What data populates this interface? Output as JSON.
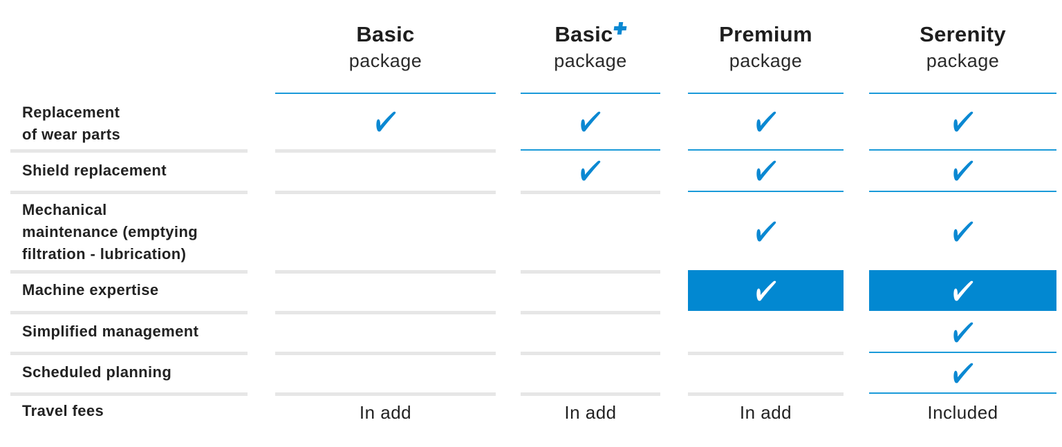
{
  "colors": {
    "accent": "#0288d1",
    "accent_line": "#1a9ad9",
    "divider_grey": "#e6e6e6",
    "text": "#222222"
  },
  "packages": [
    {
      "name": "Basic",
      "subtitle": "package",
      "badge": null
    },
    {
      "name": "Basic",
      "subtitle": "package",
      "badge": "plus-icon"
    },
    {
      "name": "Premium",
      "subtitle": "package",
      "badge": null
    },
    {
      "name": "Serenity",
      "subtitle": "package",
      "badge": null
    }
  ],
  "rows": [
    {
      "label": "Replacement\nof wear parts",
      "values": [
        "check",
        "check",
        "check",
        "check"
      ]
    },
    {
      "label": "Shield replacement",
      "values": [
        "",
        "check",
        "check",
        "check"
      ]
    },
    {
      "label": "Mechanical\nmaintenance (emptying\nfiltration - lubrication)",
      "values": [
        "",
        "",
        "check",
        "check"
      ]
    },
    {
      "label": "Machine expertise",
      "values": [
        "",
        "",
        "check-highlighted",
        "check-highlighted"
      ]
    },
    {
      "label": "Simplified management",
      "values": [
        "",
        "",
        "",
        "check"
      ]
    },
    {
      "label": "Scheduled planning",
      "values": [
        "",
        "",
        "",
        "check"
      ]
    },
    {
      "label": "Travel fees",
      "values": [
        "In add",
        "In add",
        "In add",
        "Included"
      ]
    }
  ]
}
